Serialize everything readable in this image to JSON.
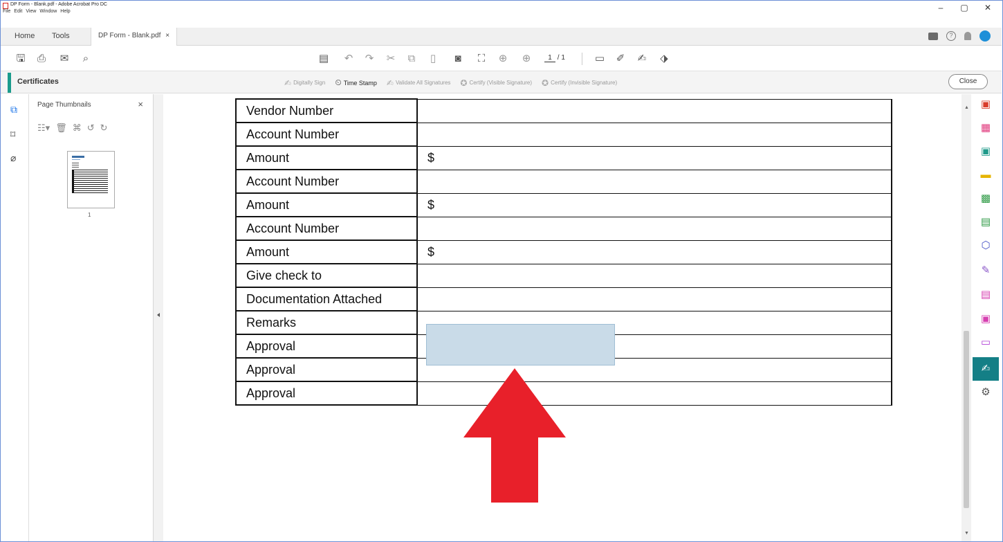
{
  "window": {
    "title": "DP Form - Blank.pdf - Adobe Acrobat Pro DC",
    "menu": [
      "File",
      "Edit",
      "View",
      "Window",
      "Help"
    ],
    "controls": [
      "–",
      "▢",
      "✕"
    ]
  },
  "tabs": {
    "home": "Home",
    "tools": "Tools",
    "document": "DP Form - Blank.pdf",
    "document_close": "×"
  },
  "toolbar": {
    "page_current": "1",
    "page_total": "/ 1"
  },
  "certificates": {
    "title": "Certificates",
    "tools": [
      {
        "label": "Digitally Sign",
        "enabled": false
      },
      {
        "label": "Time Stamp",
        "enabled": true
      },
      {
        "label": "Validate All Signatures",
        "enabled": false
      },
      {
        "label": "Certify (Visible Signature)",
        "enabled": false
      },
      {
        "label": "Certify (Invisible Signature)",
        "enabled": false
      }
    ],
    "close_label": "Close"
  },
  "thumbnails_panel": {
    "title": "Page Thumbnails",
    "close": "×",
    "page_number": "1"
  },
  "form": {
    "rows": [
      {
        "label": "Vendor Number",
        "value": ""
      },
      {
        "label": "Account Number",
        "value": ""
      },
      {
        "label": "Amount",
        "value": "$"
      },
      {
        "label": "Account Number",
        "value": ""
      },
      {
        "label": "Amount",
        "value": "$"
      },
      {
        "label": "Account Number",
        "value": ""
      },
      {
        "label": "Amount",
        "value": "$"
      },
      {
        "label": "Give check to",
        "value": ""
      },
      {
        "label": "Documentation Attached",
        "value": ""
      },
      {
        "label": "Remarks",
        "value": ""
      },
      {
        "label": "Approval",
        "value": ""
      },
      {
        "label": "Approval",
        "value": ""
      },
      {
        "label": "Approval",
        "value": ""
      }
    ]
  },
  "colors": {
    "accent": "#1a9b8c",
    "active_tool": "#147f86",
    "signature_field": "#c9dbe8",
    "arrow": "#e8202a"
  },
  "right_panel_icons": [
    {
      "name": "export-pdf-icon",
      "color": "#d93c2b",
      "glyph": "▣"
    },
    {
      "name": "organize-pages-icon",
      "color": "#e0387c",
      "glyph": "▦"
    },
    {
      "name": "create-pdf-icon",
      "color": "#1f9a8a",
      "glyph": "▣"
    },
    {
      "name": "comment-icon",
      "color": "#e6b400",
      "glyph": "▬"
    },
    {
      "name": "export-excel-icon",
      "color": "#2e9a45",
      "glyph": "▩"
    },
    {
      "name": "print-production-icon",
      "color": "#2e9a45",
      "glyph": "▤"
    },
    {
      "name": "protect-icon",
      "color": "#4a55c8",
      "glyph": "⬡"
    },
    {
      "name": "fill-sign-icon",
      "color": "#8a56c8",
      "glyph": "✎"
    },
    {
      "name": "edit-pdf-icon",
      "color": "#d63fb0",
      "glyph": "▤"
    },
    {
      "name": "save-icon",
      "color": "#d63fb0",
      "glyph": "▣"
    },
    {
      "name": "measure-icon",
      "color": "#b03fd6",
      "glyph": "▭"
    },
    {
      "name": "certificates-icon",
      "color": "#ffffff",
      "glyph": "✍",
      "active": true
    },
    {
      "name": "more-tools-icon",
      "color": "#555555",
      "glyph": "⚙"
    }
  ]
}
